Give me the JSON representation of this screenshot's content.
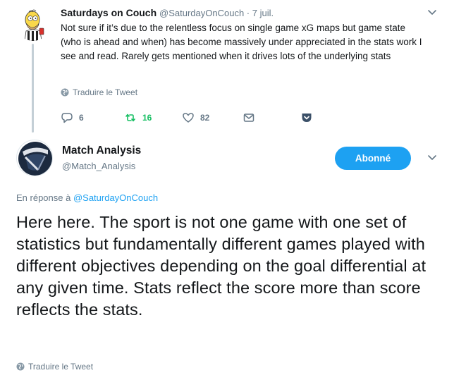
{
  "parent_tweet": {
    "author_name": "Saturdays on Couch",
    "handle": "@SaturdayOnCouch",
    "separator": " · ",
    "date": "7 juil.",
    "text": "Not sure if it’s due to the relentless focus on single game xG maps but game state (who is ahead and when) has become massively under appreciated in the stats work I see and read. Rarely gets mentioned when it drives lots of the underlying stats",
    "translate_label": "Traduire le Tweet",
    "reply_count": "6",
    "retweet_count": "16",
    "like_count": "82",
    "colors": {
      "retweet_active": "#17bf63",
      "icon_gray": "#657786",
      "pocket": "#3b5068"
    }
  },
  "focal_tweet": {
    "author_name": "Match Analysis",
    "handle": "@Match_Analysis",
    "follow_label": "Abonné",
    "reply_prefix": "En réponse à ",
    "reply_mention": "@SaturdayOnCouch",
    "text": "Here here. The sport is not one game with one set of statistics but fundamentally different games played with different objectives depending on the goal differential at any given time. Stats reflect the score more than score reflects the stats.",
    "translate_label": "Traduire le Tweet",
    "colors": {
      "accent": "#1da1f2",
      "logo_dark": "#1c2a3f",
      "logo_light": "#dfe3ea"
    }
  }
}
